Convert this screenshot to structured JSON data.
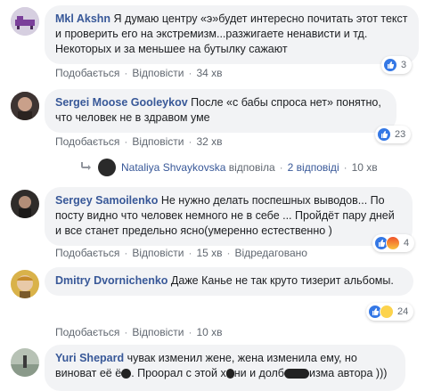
{
  "actions": {
    "like": "Подобається",
    "reply": "Відповісти",
    "edited": "Відредаговано"
  },
  "comments": [
    {
      "author": "Mkl Akshn",
      "text": "Я думаю центру «э»будет интересно почитать этот текст и проверить его на экстремизм...разжигаете ненависти и тд. Некоторых и за меньшее на бутылку сажают",
      "time": "34 хв",
      "reaction_count": "3"
    },
    {
      "author": "Sergei Moose Gooleykov",
      "text": "После «с бабы спроса нет» понятно, что человек не в здравом уме",
      "time": "32 хв",
      "reaction_count": "23"
    },
    {
      "author": "Sergey Samoilenko",
      "text": "Не нужно делать поспешных выводов... По посту видно что человек немного не в себе ... Пройдёт пару дней и все станет предельно ясно(умеренно естественно )",
      "time": "15 хв",
      "reaction_count": "4"
    },
    {
      "author": "Dmitry Dvornichenko",
      "text": "Даже Канье не так круто тизерит альбомы.",
      "time": "10 хв",
      "reaction_count": "24"
    },
    {
      "author": "Yuri Shepard",
      "text_part1": "чувак изменил жене, жена изменила ему, но виноват её ё",
      "text_part2": ". Проорал с этой х",
      "text_part3": "ни и долб",
      "text_part4": "изма автора )))"
    }
  ],
  "reply": {
    "author": "Nataliya Shvaykovska",
    "verb": "відповіла",
    "count": "2 відповіді",
    "time": "10 хв"
  }
}
